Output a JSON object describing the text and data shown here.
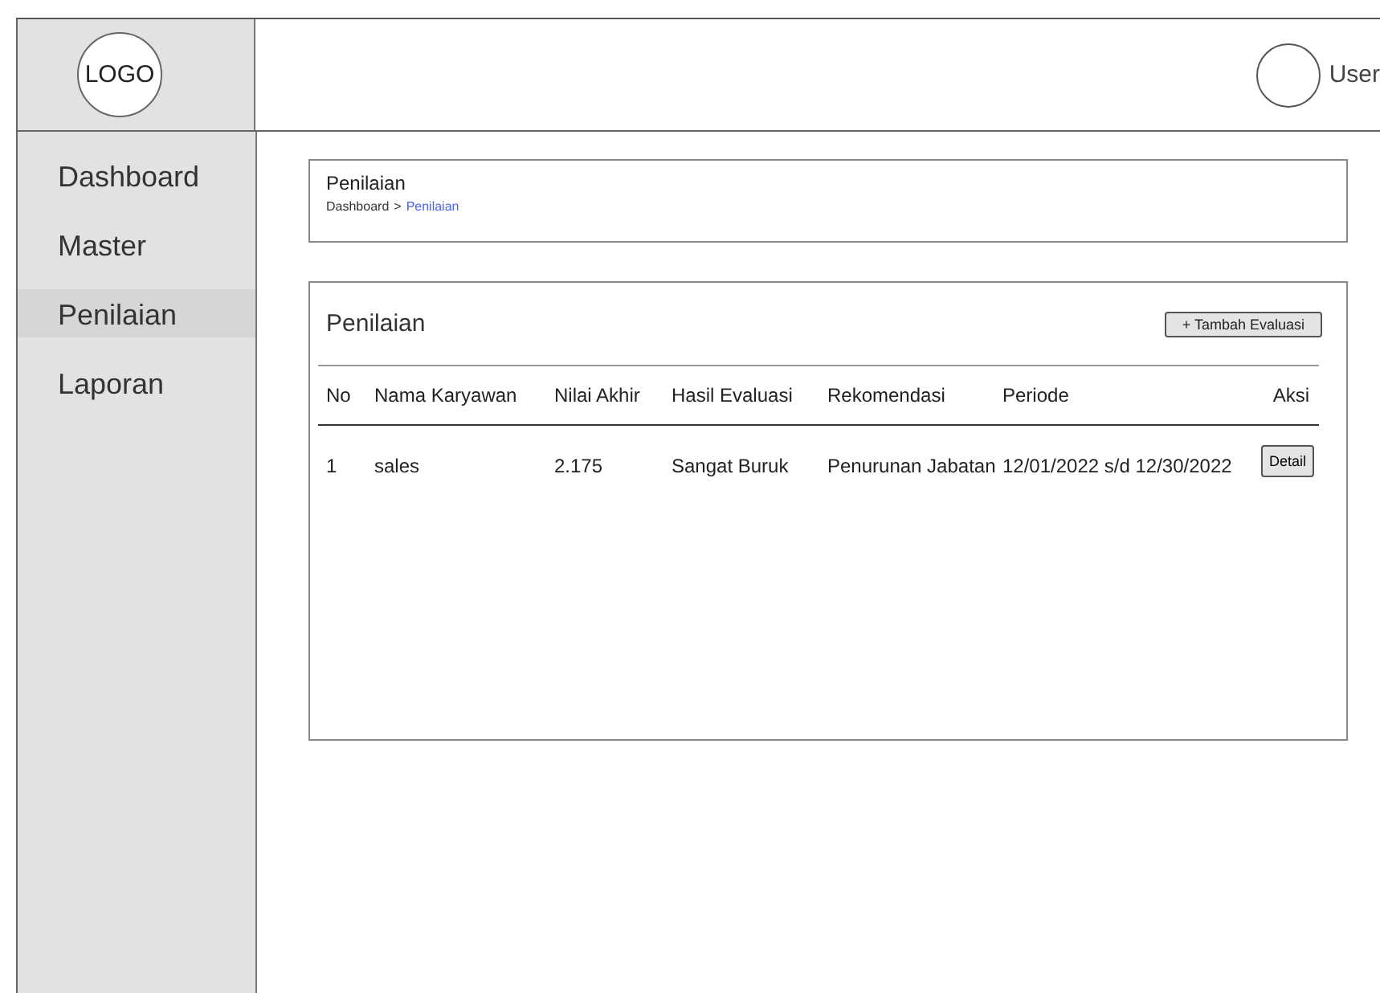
{
  "header": {
    "logo": "LOGO",
    "user": "User"
  },
  "sidebar": {
    "items": [
      {
        "label": "Dashboard",
        "selected": false
      },
      {
        "label": "Master",
        "selected": false
      },
      {
        "label": "Penilaian",
        "selected": true
      },
      {
        "label": "Laporan",
        "selected": false
      }
    ]
  },
  "breadcrumb_card": {
    "title": "Penilaian",
    "breadcrumb": [
      {
        "label": "Dashboard",
        "selected": false
      },
      {
        "label": "Penilaian",
        "selected": true
      }
    ],
    "separator": ">"
  },
  "table_card": {
    "title": "Penilaian",
    "add_button": "+ Tambah Evaluasi",
    "columns": [
      "No",
      "Nama Karyawan",
      "Nilai Akhir",
      "Hasil Evaluasi",
      "Rekomendasi",
      "Periode",
      "Aksi"
    ],
    "rows": [
      {
        "cells": [
          "1",
          "sales",
          "2.175",
          "Sangat Buruk",
          "Penurunan Jabatan",
          "12/01/2022 s/d 12/30/2022"
        ],
        "action": "Detail"
      }
    ]
  }
}
